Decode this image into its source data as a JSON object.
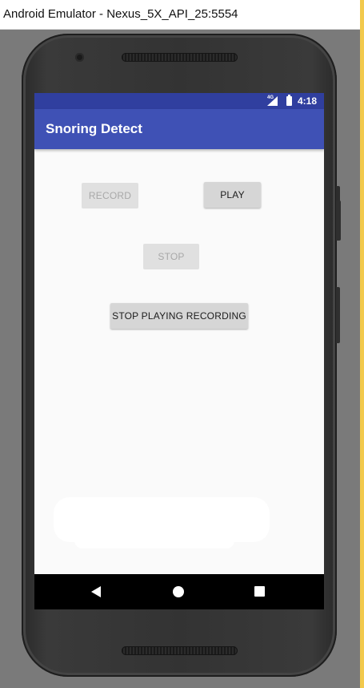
{
  "window": {
    "title": "Android Emulator - Nexus_5X_API_25:5554"
  },
  "status_bar": {
    "network": "4G",
    "time": "4:18",
    "icons": [
      "signal-icon",
      "battery-icon"
    ]
  },
  "app_bar": {
    "title": "Snoring Detect",
    "color": "#3f51b5",
    "status_color": "#303f9f"
  },
  "buttons": {
    "record": {
      "label": "RECORD",
      "enabled": false
    },
    "play": {
      "label": "PLAY",
      "enabled": true
    },
    "stop": {
      "label": "STOP",
      "enabled": false
    },
    "stop_playing": {
      "label": "STOP PLAYING RECORDING",
      "enabled": true
    }
  },
  "nav_bar": {
    "icons": [
      "back-icon",
      "home-icon",
      "recents-icon"
    ]
  }
}
